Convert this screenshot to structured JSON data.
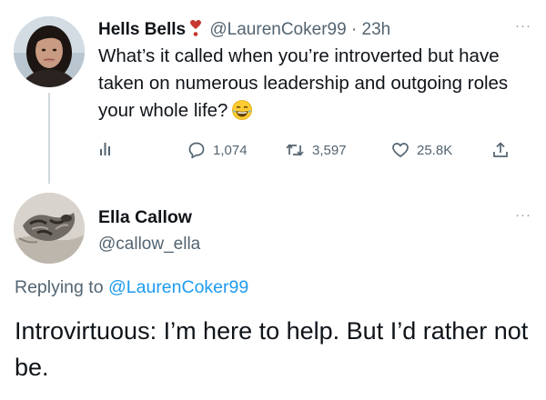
{
  "tweet": {
    "author": {
      "display_name": "Hells Bells",
      "emoji": "heart-exclamation",
      "handle": "@LaurenCoker99",
      "separator": "·",
      "time": "23h"
    },
    "text": "What’s it called when you’re introverted but have taken on numerous leadership and outgoing roles your whole life?",
    "trailing_emoji": "face-with-tears-of-joy",
    "stats": {
      "replies": "1,074",
      "retweets": "3,597",
      "likes": "25.8K"
    },
    "icons": [
      "analytics-icon",
      "reply-icon",
      "retweet-icon",
      "like-icon",
      "share-icon",
      "more-icon"
    ]
  },
  "reply": {
    "author": {
      "display_name": "Ella Callow",
      "handle": "@callow_ella"
    },
    "replying_label": "Replying to",
    "replying_to": "@LaurenCoker99",
    "text": "Introvirtuous: I’m here to help. But I’d rather not be."
  },
  "colors": {
    "text": "#0f1419",
    "muted": "#536471",
    "link": "#1d9bf0",
    "thread_line": "#cfd9de"
  }
}
